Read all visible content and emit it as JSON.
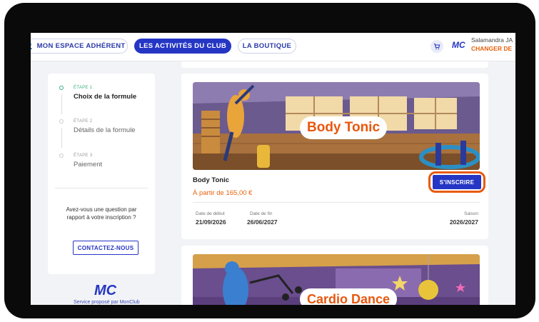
{
  "nav": {
    "espace": "MON ESPACE ADHÉRENT",
    "activites": "LES ACTIVITÉS DU CLUB",
    "boutique": "LA BOUTIQUE",
    "user_name": "Salamandra JA",
    "change_label": "CHANGER DE"
  },
  "steps": [
    {
      "num": "ÉTAPE 1",
      "title": "Choix de la formule",
      "active": true
    },
    {
      "num": "ÉTAPE 2",
      "title": "Détails de la formule",
      "active": false
    },
    {
      "num": "ÉTAPE 3",
      "title": "Paiement",
      "active": false
    }
  ],
  "help": {
    "question": "Avez-vous une question par rapport à votre inscription ?",
    "contact": "CONTACTEZ-NOUS"
  },
  "footer": {
    "logo": "MC",
    "powered": "Service proposé par MonClub"
  },
  "activity": {
    "banner_title": "Body Tonic",
    "name": "Body Tonic",
    "price": "À partir de 165,00 €",
    "button": "S'INSCRIRE",
    "start_label": "Date de début",
    "start_value": "21/09/2026",
    "end_label": "Date de fin",
    "end_value": "26/06/2027",
    "season_label": "Saison",
    "season_value": "2026/2027"
  },
  "activity2": {
    "banner_title": "Cardio Dance"
  },
  "colors": {
    "brand_blue": "#2536c4",
    "accent_orange": "#e8620d",
    "step_green": "#39b27a"
  }
}
